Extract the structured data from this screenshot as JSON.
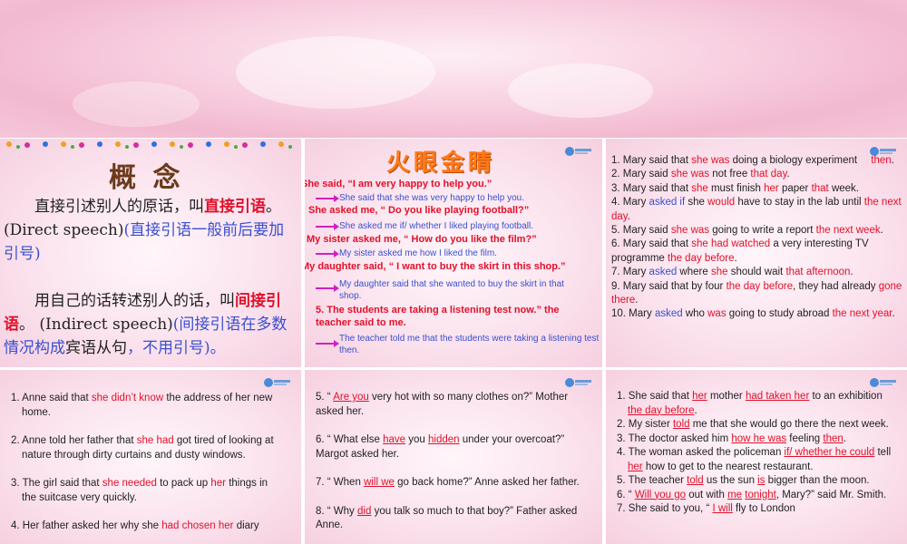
{
  "slide1": {
    "title": "概 念",
    "p1_a": "直接引述别人的原话，叫",
    "p1_b": "直接引语",
    "p1_c": "。 (Direct speech)",
    "p1_d": "(直接引语一般前后要加引号)",
    "p2_a": "用自己的话转述别人的话，叫",
    "p2_b": "间接引语",
    "p2_c": "。 (Indirect speech)",
    "p2_d": "(间接引语在多数情况构成",
    "p2_e": "宾语从句",
    "p2_f": "，不用引号)。"
  },
  "slide2": {
    "title": "火眼金睛",
    "items": [
      {
        "direct": "She said, “I am very happy to help you.”",
        "indirect": "She said that she was very happy to help you."
      },
      {
        "direct": "She asked me, “ Do you like playing football?”",
        "indirect": "She asked me if/ whether I liked playing football."
      },
      {
        "direct": "My sister asked me, “ How do you like the film?”",
        "indirect": "My sister asked me how I liked the film."
      },
      {
        "direct": "My daughter said, “ I want to buy the skirt in this shop.”",
        "indirect": "My daughter said that she wanted to buy the skirt in that shop."
      },
      {
        "direct": "5. The students are taking a listening test now.” the teacher said to me.",
        "indirect": "The teacher told me that the students were taking a listening test then."
      }
    ]
  },
  "slide3": {
    "s1": [
      "1. Mary said that ",
      "she was",
      " doing a biology experiment ",
      "then",
      "."
    ],
    "s2": [
      "2. Mary said ",
      "she was",
      " not free ",
      "that day",
      "."
    ],
    "s3": [
      "3. Mary said that ",
      "she",
      " must finish ",
      "her",
      " paper ",
      "that",
      " week."
    ],
    "s4": [
      "4. Mary ",
      "asked if",
      " she ",
      "would",
      " have to stay in the lab until ",
      "the next day",
      "."
    ],
    "s5": [
      "5. Mary said ",
      "she was",
      " going to write a report ",
      "the next week",
      "."
    ],
    "s6": [
      "6. Mary said that ",
      "she had watched",
      " a very interesting TV programme ",
      "the day before",
      "."
    ],
    "s7": [
      "7. Mary ",
      "asked",
      " where ",
      "she",
      " should wait ",
      "that afternoon",
      "."
    ],
    "s9": [
      "9. Mary said that by four ",
      "the day before",
      ", they had already ",
      "gone there",
      "."
    ],
    "s10": [
      "10. Mary ",
      "asked",
      " who ",
      "was",
      " going to study abroad ",
      "the next year",
      "."
    ]
  },
  "slide4": {
    "s1": [
      "1. Anne said that ",
      "she didn’t know",
      " the address of her new home."
    ],
    "s2": [
      "2. Anne told her father that ",
      "she had",
      " got tired of looking at nature through dirty curtains and dusty windows."
    ],
    "s3": [
      "3. The girl said that ",
      "she needed",
      " to pack up ",
      "her",
      " things in the suitcase very quickly."
    ],
    "s4": [
      "4. Her father asked her why she ",
      "had chosen her",
      " diary"
    ]
  },
  "slide5": {
    "s5": [
      "5.  “ ",
      "Are you",
      " very hot with so many clothes on?” Mother asked her."
    ],
    "s6": [
      "6.  “ What else ",
      "have",
      " you ",
      "hidden",
      " under your overcoat?”  Margot asked her."
    ],
    "s7": [
      "7.  “ When ",
      "will we",
      " go back home?”  Anne asked her father."
    ],
    "s8": [
      "8.  “ Why ",
      "did",
      " you talk so much to that boy?”  Father asked Anne."
    ]
  },
  "slide6": {
    "s1": [
      "1. She said that ",
      "her",
      " mother ",
      "had taken her",
      " to an exhibition ",
      "the day before",
      "."
    ],
    "s2": [
      "2. My sister ",
      "told",
      " me that she would go there the next week."
    ],
    "s3": [
      "3. The doctor asked him ",
      "how he was",
      " feeling ",
      "then",
      "."
    ],
    "s4": [
      "4. The woman asked the policeman ",
      "if/ whether he could",
      " tell ",
      "her",
      " how to get to the nearest restaurant."
    ],
    "s5": [
      "5. The teacher ",
      "told",
      " us the sun ",
      "is",
      " bigger than the moon."
    ],
    "s6": [
      "6.  “ ",
      "Will you go",
      " out with ",
      "me",
      " ",
      "tonight",
      ", Mary?”  said Mr. Smith."
    ],
    "s7": [
      "7. She said to you,  “ ",
      "I will",
      " fly to London"
    ]
  },
  "colors": {
    "red": "#e0102a",
    "blue": "#3a4fd0",
    "magenta_arrow": "#d020c0"
  }
}
